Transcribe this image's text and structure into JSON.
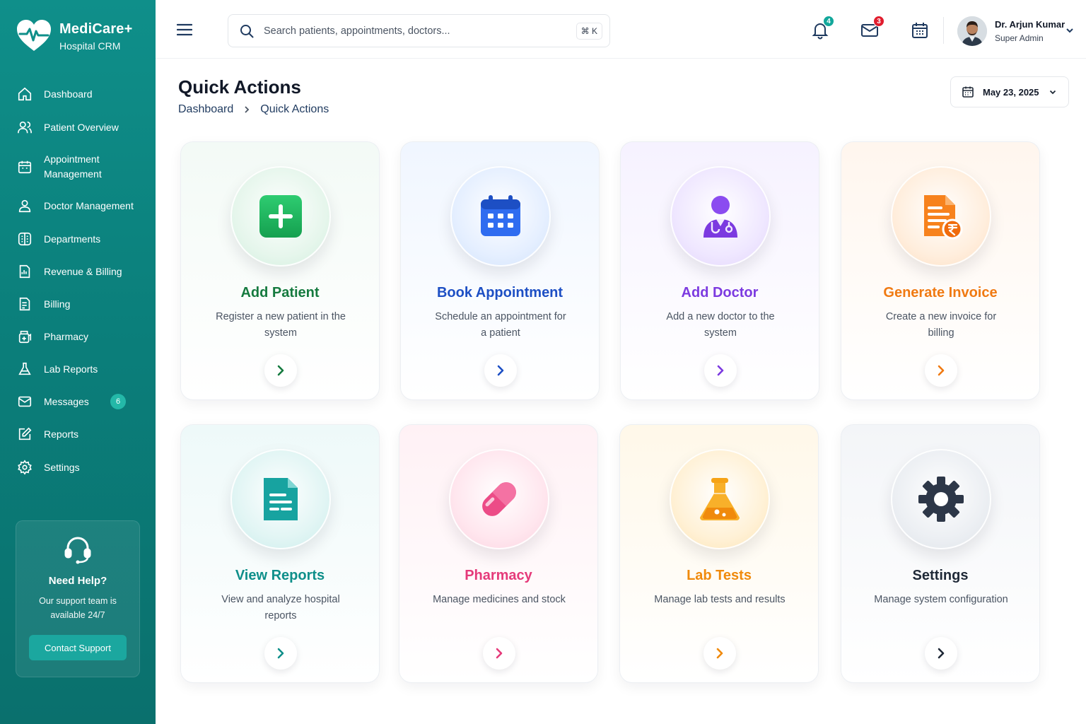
{
  "brand": {
    "name": "MediCare+",
    "subtitle": "Hospital CRM",
    "logo_icon": "heart-pulse-icon"
  },
  "sidebar": {
    "items": [
      {
        "label": "Dashboard",
        "icon": "home-icon"
      },
      {
        "label": "Patient Overview",
        "icon": "users-icon"
      },
      {
        "label": "Appointment\nManagement",
        "icon": "calendar-icon"
      },
      {
        "label": "Doctor Management",
        "icon": "user-icon"
      },
      {
        "label": "Departments",
        "icon": "building-icon"
      },
      {
        "label": "Revenue & Billing",
        "icon": "receipt-icon"
      },
      {
        "label": "Billing",
        "icon": "invoice-icon"
      },
      {
        "label": "Pharmacy",
        "icon": "pharmacy-icon"
      },
      {
        "label": "Lab Reports",
        "icon": "flask-icon"
      },
      {
        "label": "Messages",
        "icon": "mail-icon",
        "badge": "6"
      },
      {
        "label": "Reports",
        "icon": "edit-icon"
      },
      {
        "label": "Settings",
        "icon": "gear-icon"
      }
    ],
    "help": {
      "title": "Need Help?",
      "text": "Our support team is available 24/7",
      "button": "Contact Support",
      "icon": "headset-icon"
    }
  },
  "topbar": {
    "search_placeholder": "Search patients, appointments, doctors...",
    "search_shortcut": "⌘ K",
    "notifications_count": "4",
    "messages_count": "3",
    "user": {
      "name": "Dr. Arjun Kumar",
      "role": "Super Admin"
    }
  },
  "page": {
    "title": "Quick Actions",
    "breadcrumb": [
      "Dashboard",
      "Quick Actions"
    ],
    "date": "May 23, 2025"
  },
  "cards": [
    {
      "title": "Add Patient",
      "desc": "Register a new patient in the system",
      "color": "#157a3f",
      "icon": "plus-icon"
    },
    {
      "title": "Book Appointment",
      "desc": "Schedule an appointment for a patient",
      "color": "#1d4fc4",
      "icon": "calendar-icon"
    },
    {
      "title": "Add Doctor",
      "desc": "Add a new doctor to the system",
      "color": "#7c3ae0",
      "icon": "doctor-icon"
    },
    {
      "title": "Generate Invoice",
      "desc": "Create a new invoice for billing",
      "color": "#f07a12",
      "icon": "invoice-rupee-icon"
    },
    {
      "title": "View Reports",
      "desc": "View and analyze hospital reports",
      "color": "#0f8f8a",
      "icon": "document-icon"
    },
    {
      "title": "Pharmacy",
      "desc": "Manage medicines and stock",
      "color": "#e53a7a",
      "icon": "pill-icon"
    },
    {
      "title": "Lab Tests",
      "desc": "Manage lab tests and results",
      "color": "#f08a0c",
      "icon": "flask-icon"
    },
    {
      "title": "Settings",
      "desc": "Manage system configuration",
      "color": "#1f2937",
      "icon": "gear-icon"
    }
  ]
}
